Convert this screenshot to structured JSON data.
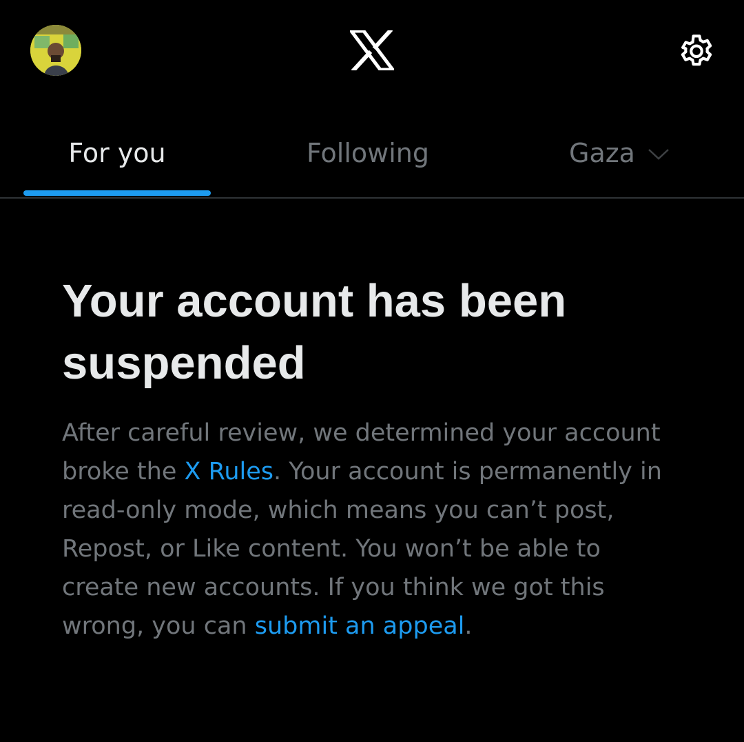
{
  "header": {
    "avatar_icon": "user-avatar",
    "logo_icon": "x-logo-icon",
    "settings_icon": "gear-icon"
  },
  "tabs": [
    {
      "label": "For you",
      "active": true
    },
    {
      "label": "Following",
      "active": false
    },
    {
      "label": "Gaza",
      "active": false,
      "icon": "chevron-down-icon"
    }
  ],
  "suspension": {
    "title": "Your account has been suspended",
    "body_part1": "After careful review, we determined your account broke the ",
    "rules_link": "X Rules",
    "body_part2": ". Your account is permanently in read-only mode, which means you can’t post, Repost, or Like content. You won’t be able to create new accounts. If you think we got this wrong, you can ",
    "appeal_link": "submit an appeal",
    "body_part3": "."
  },
  "colors": {
    "background": "#000000",
    "primary_text": "#e7e9ea",
    "secondary_text": "#71767b",
    "accent": "#1d9bf0",
    "divider": "#2f3336"
  }
}
